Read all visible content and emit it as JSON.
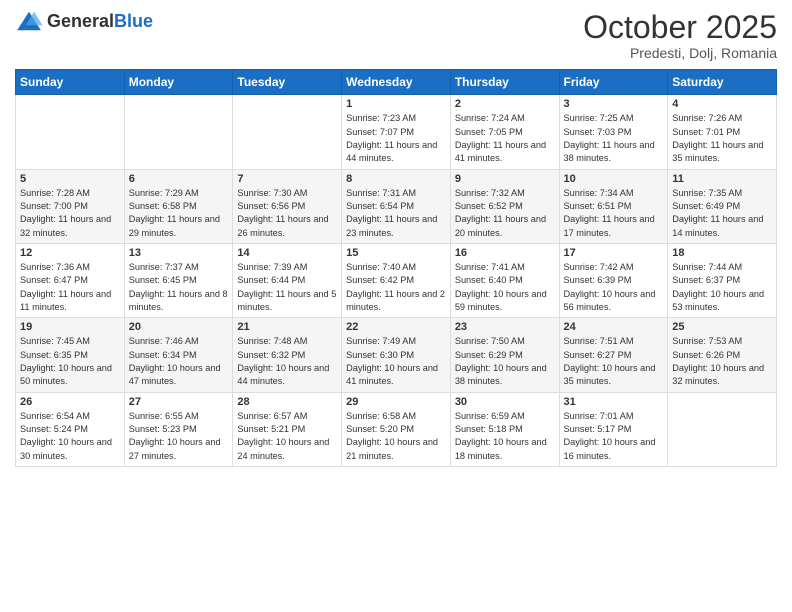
{
  "logo": {
    "general": "General",
    "blue": "Blue"
  },
  "header": {
    "month": "October 2025",
    "location": "Predesti, Dolj, Romania"
  },
  "weekdays": [
    "Sunday",
    "Monday",
    "Tuesday",
    "Wednesday",
    "Thursday",
    "Friday",
    "Saturday"
  ],
  "weeks": [
    [
      {
        "day": "",
        "info": ""
      },
      {
        "day": "",
        "info": ""
      },
      {
        "day": "",
        "info": ""
      },
      {
        "day": "1",
        "info": "Sunrise: 7:23 AM\nSunset: 7:07 PM\nDaylight: 11 hours and 44 minutes."
      },
      {
        "day": "2",
        "info": "Sunrise: 7:24 AM\nSunset: 7:05 PM\nDaylight: 11 hours and 41 minutes."
      },
      {
        "day": "3",
        "info": "Sunrise: 7:25 AM\nSunset: 7:03 PM\nDaylight: 11 hours and 38 minutes."
      },
      {
        "day": "4",
        "info": "Sunrise: 7:26 AM\nSunset: 7:01 PM\nDaylight: 11 hours and 35 minutes."
      }
    ],
    [
      {
        "day": "5",
        "info": "Sunrise: 7:28 AM\nSunset: 7:00 PM\nDaylight: 11 hours and 32 minutes."
      },
      {
        "day": "6",
        "info": "Sunrise: 7:29 AM\nSunset: 6:58 PM\nDaylight: 11 hours and 29 minutes."
      },
      {
        "day": "7",
        "info": "Sunrise: 7:30 AM\nSunset: 6:56 PM\nDaylight: 11 hours and 26 minutes."
      },
      {
        "day": "8",
        "info": "Sunrise: 7:31 AM\nSunset: 6:54 PM\nDaylight: 11 hours and 23 minutes."
      },
      {
        "day": "9",
        "info": "Sunrise: 7:32 AM\nSunset: 6:52 PM\nDaylight: 11 hours and 20 minutes."
      },
      {
        "day": "10",
        "info": "Sunrise: 7:34 AM\nSunset: 6:51 PM\nDaylight: 11 hours and 17 minutes."
      },
      {
        "day": "11",
        "info": "Sunrise: 7:35 AM\nSunset: 6:49 PM\nDaylight: 11 hours and 14 minutes."
      }
    ],
    [
      {
        "day": "12",
        "info": "Sunrise: 7:36 AM\nSunset: 6:47 PM\nDaylight: 11 hours and 11 minutes."
      },
      {
        "day": "13",
        "info": "Sunrise: 7:37 AM\nSunset: 6:45 PM\nDaylight: 11 hours and 8 minutes."
      },
      {
        "day": "14",
        "info": "Sunrise: 7:39 AM\nSunset: 6:44 PM\nDaylight: 11 hours and 5 minutes."
      },
      {
        "day": "15",
        "info": "Sunrise: 7:40 AM\nSunset: 6:42 PM\nDaylight: 11 hours and 2 minutes."
      },
      {
        "day": "16",
        "info": "Sunrise: 7:41 AM\nSunset: 6:40 PM\nDaylight: 10 hours and 59 minutes."
      },
      {
        "day": "17",
        "info": "Sunrise: 7:42 AM\nSunset: 6:39 PM\nDaylight: 10 hours and 56 minutes."
      },
      {
        "day": "18",
        "info": "Sunrise: 7:44 AM\nSunset: 6:37 PM\nDaylight: 10 hours and 53 minutes."
      }
    ],
    [
      {
        "day": "19",
        "info": "Sunrise: 7:45 AM\nSunset: 6:35 PM\nDaylight: 10 hours and 50 minutes."
      },
      {
        "day": "20",
        "info": "Sunrise: 7:46 AM\nSunset: 6:34 PM\nDaylight: 10 hours and 47 minutes."
      },
      {
        "day": "21",
        "info": "Sunrise: 7:48 AM\nSunset: 6:32 PM\nDaylight: 10 hours and 44 minutes."
      },
      {
        "day": "22",
        "info": "Sunrise: 7:49 AM\nSunset: 6:30 PM\nDaylight: 10 hours and 41 minutes."
      },
      {
        "day": "23",
        "info": "Sunrise: 7:50 AM\nSunset: 6:29 PM\nDaylight: 10 hours and 38 minutes."
      },
      {
        "day": "24",
        "info": "Sunrise: 7:51 AM\nSunset: 6:27 PM\nDaylight: 10 hours and 35 minutes."
      },
      {
        "day": "25",
        "info": "Sunrise: 7:53 AM\nSunset: 6:26 PM\nDaylight: 10 hours and 32 minutes."
      }
    ],
    [
      {
        "day": "26",
        "info": "Sunrise: 6:54 AM\nSunset: 5:24 PM\nDaylight: 10 hours and 30 minutes."
      },
      {
        "day": "27",
        "info": "Sunrise: 6:55 AM\nSunset: 5:23 PM\nDaylight: 10 hours and 27 minutes."
      },
      {
        "day": "28",
        "info": "Sunrise: 6:57 AM\nSunset: 5:21 PM\nDaylight: 10 hours and 24 minutes."
      },
      {
        "day": "29",
        "info": "Sunrise: 6:58 AM\nSunset: 5:20 PM\nDaylight: 10 hours and 21 minutes."
      },
      {
        "day": "30",
        "info": "Sunrise: 6:59 AM\nSunset: 5:18 PM\nDaylight: 10 hours and 18 minutes."
      },
      {
        "day": "31",
        "info": "Sunrise: 7:01 AM\nSunset: 5:17 PM\nDaylight: 10 hours and 16 minutes."
      },
      {
        "day": "",
        "info": ""
      }
    ]
  ]
}
